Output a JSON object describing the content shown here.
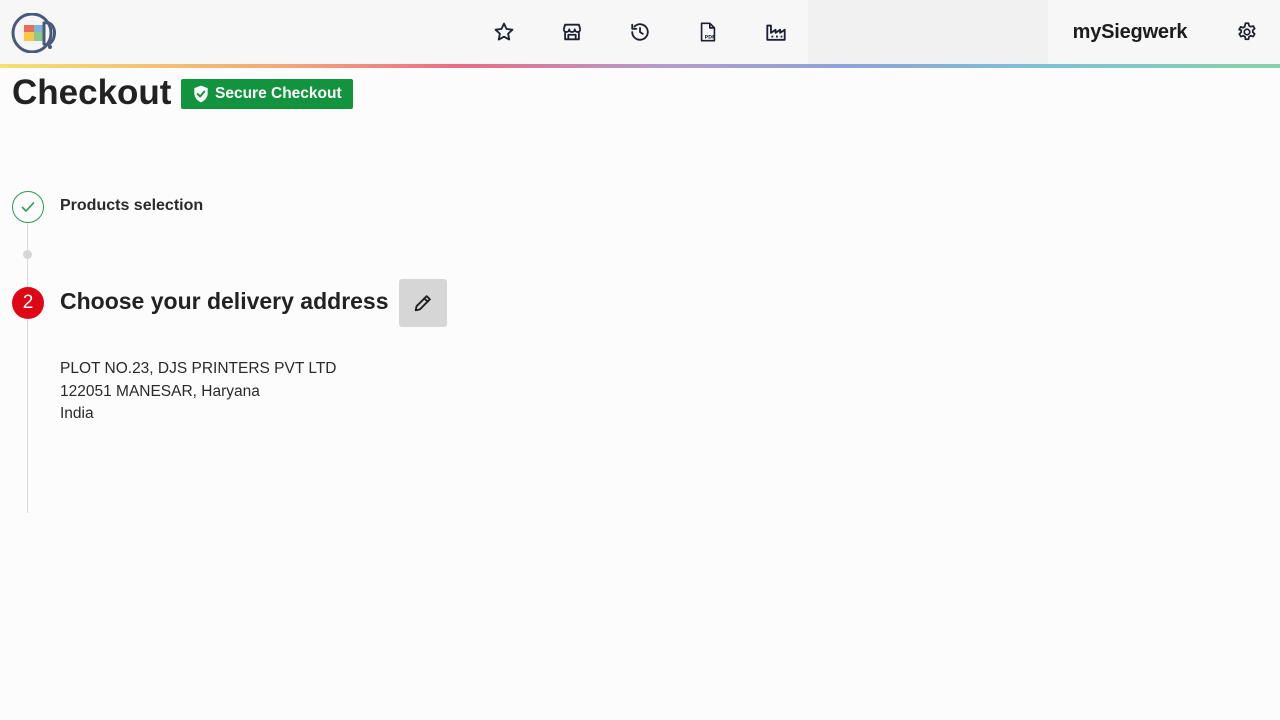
{
  "header": {
    "brand": "mySiegwerk",
    "logo_icon": "color-palette-logo",
    "nav_items": [
      {
        "icon": "star-icon",
        "label": "Favorites"
      },
      {
        "icon": "store-icon",
        "label": "Shop"
      },
      {
        "icon": "history-icon",
        "label": "Order history"
      },
      {
        "icon": "pdf-file-icon",
        "label": "Documents"
      },
      {
        "icon": "factory-icon",
        "label": "Plants"
      }
    ],
    "settings_icon": "gear-icon"
  },
  "page": {
    "title": "Checkout",
    "badge": {
      "label": "Secure Checkout",
      "icon": "shield-check-icon",
      "color": "#12943f"
    }
  },
  "stepper": {
    "steps": [
      {
        "status": "completed",
        "label": "Products selection",
        "icon": "check-icon"
      },
      {
        "status": "active",
        "number": "2",
        "label": "Choose your delivery address",
        "action_icon": "pencil-icon"
      }
    ]
  },
  "address": {
    "line1": "PLOT NO.23, DJS PRINTERS PVT LTD",
    "line2": "122051 MANESAR, Haryana",
    "line3": "India"
  },
  "colors": {
    "success": "#12943f",
    "active_step": "#de0716",
    "completed_step": "#2b9a52"
  }
}
